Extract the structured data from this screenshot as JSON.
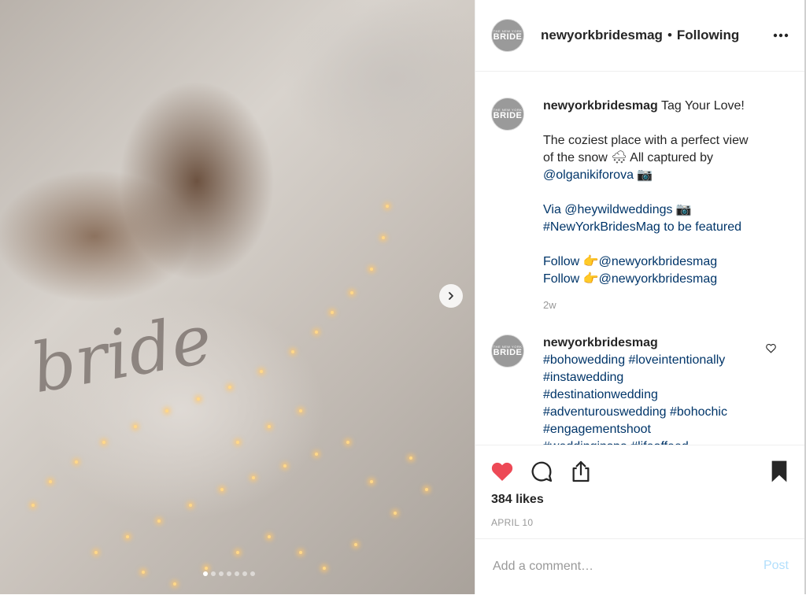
{
  "account": {
    "username": "newyorkbridesmag",
    "separator": "•",
    "follow_state": "Following",
    "avatar_top": "THE NEW YORK",
    "avatar_main": "BRIDE"
  },
  "media": {
    "photo_text": "bride",
    "carousel_count": 7,
    "active_index": 0
  },
  "caption": {
    "username": "newyorkbridesmag",
    "lines": [
      "Tag Your Love!",
      "",
      "The coziest place with a perfect view",
      "of the snow 🌨 All captured by",
      "@olganikiforova 📷",
      "",
      "Via @heywildweddings 📷",
      "#NewYorkBridesMag to be featured",
      "",
      "Follow 👉@newyorkbridesmag",
      "Follow 👉@newyorkbridesmag"
    ],
    "age": "2w"
  },
  "comment": {
    "username": "newyorkbridesmag",
    "tags": [
      "#bohowedding #loveintentionally",
      "#instawedding",
      "#destinationwedding",
      "#adventurouswedding #bohochic",
      "#engagementshoot",
      "#weddinginspo #lifeoffeed"
    ]
  },
  "actions": {
    "likes": "384 likes",
    "date": "APRIL 10",
    "like_color": "#ed4956"
  },
  "add_comment": {
    "placeholder": "Add a comment…",
    "post_label": "Post"
  }
}
